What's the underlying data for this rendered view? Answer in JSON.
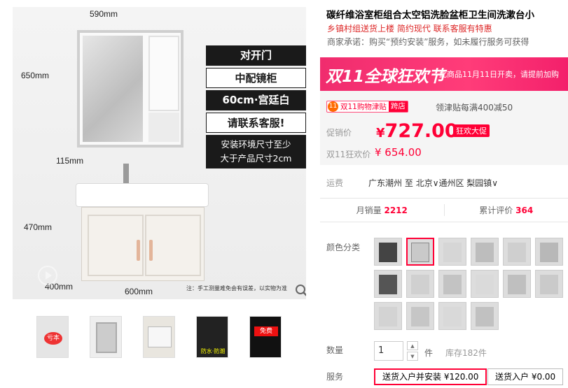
{
  "gallery": {
    "dims": {
      "width": "590mm",
      "mirror_h": "650mm",
      "depth_top": "115mm",
      "cab_h": "470mm",
      "depth_bot": "400mm",
      "width_bot": "600mm"
    },
    "promo_lines": [
      "对开门",
      "中配镜柜",
      "60cm·宫廷白",
      "请联系客服!"
    ],
    "promo_note": [
      "安装环境尺寸至少",
      "大于产品尺寸2cm"
    ],
    "note": "注：手工测量难免会有误差，以实物为准",
    "thumbs": [
      {
        "label": "亏本"
      },
      {
        "label": ""
      },
      {
        "label": ""
      },
      {
        "label": "防水·防潮"
      },
      {
        "label": "免费"
      }
    ]
  },
  "product": {
    "title": "碳纤维浴室柜组合太空铝洗脸盆柜卫生间洗漱台小",
    "subtitle": "乡镇村组送货上楼 简约现代 联系客服有特惠",
    "promise": "商家承诺：购买“预约安装”服务，如未履行服务可获得"
  },
  "banner": {
    "logo": "双11全球狂欢节",
    "tag": "此商品11月11日开卖，请提前加购"
  },
  "price": {
    "badge_icon": "11",
    "badge_text": "双11购物津贴",
    "badge_cross": "跨店",
    "coupon": "领津贴每满400减50",
    "label_sale": "促销价",
    "currency": "¥",
    "value": "727.00",
    "hot_tag": "狂欢大促",
    "label_d11": "双11狂欢价",
    "d11_value": "¥ 654.00"
  },
  "shipping": {
    "label": "运费",
    "from": "广东潮州",
    "to_word": "至",
    "dest": "北京∨通州区 梨园镇∨"
  },
  "stats": {
    "monthly_label": "月销量",
    "monthly": "2212",
    "reviews_label": "累计评价",
    "reviews": "364"
  },
  "options": {
    "color_label": "颜色分类",
    "qty_label": "数量",
    "qty_value": "1",
    "unit": "件",
    "stock": "库存182件",
    "service_label": "服务"
  },
  "services": [
    {
      "label": "送货入户并安装 ¥120.00",
      "selected": true
    },
    {
      "label": "送货入户 ¥0.00",
      "selected": false
    }
  ],
  "colors": {
    "accent": "#ff0036",
    "banner": "#f02c6e"
  }
}
